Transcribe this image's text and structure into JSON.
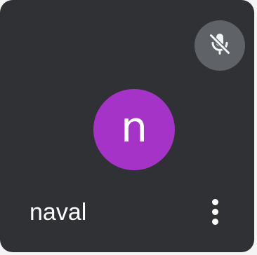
{
  "tile": {
    "participant_name": "naval",
    "avatar_initial": "n",
    "avatar_color": "#a533c8",
    "mic_status_icon": "mic-off-icon",
    "more_options_icon": "more-vert-icon"
  },
  "colors": {
    "tile_background": "#303134",
    "mic_badge_background": "#5f6368",
    "text": "#ffffff"
  }
}
